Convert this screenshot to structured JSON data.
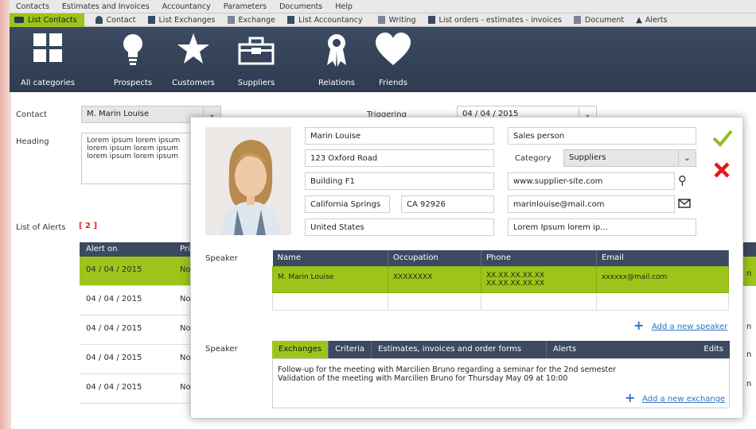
{
  "menu": [
    "Contacts",
    "Estimates and Invoices",
    "Accountancy",
    "Parameters",
    "Documents",
    "Help"
  ],
  "tabs": [
    {
      "label": "List Contacts",
      "icon": "contacts-icon",
      "active": true
    },
    {
      "label": "Contact",
      "icon": "person-icon"
    },
    {
      "label": "List Exchanges",
      "icon": "book-icon"
    },
    {
      "label": "Exchange",
      "icon": "document-icon"
    },
    {
      "label": "List Accountancy",
      "icon": "book-icon"
    },
    {
      "label": "Writing",
      "icon": "document-icon"
    },
    {
      "label": "List orders - estimates - invoices",
      "icon": "book-icon"
    },
    {
      "label": "Document",
      "icon": "document-icon"
    },
    {
      "label": "Alerts",
      "icon": "warning-icon"
    }
  ],
  "toolbar": [
    {
      "label": "All categories",
      "icon": "grid-icon"
    },
    {
      "label": "Prospects",
      "icon": "lightbulb-icon"
    },
    {
      "label": "Customers",
      "icon": "star-icon"
    },
    {
      "label": "Suppliers",
      "icon": "toolbox-icon"
    },
    {
      "label": "Relations",
      "icon": "ribbon-icon"
    },
    {
      "label": "Friends",
      "icon": "heart-icon"
    }
  ],
  "form": {
    "contact_label": "Contact",
    "contact_value": "M. Marin Louise",
    "triggering_label": "Triggering",
    "triggering_value": "04 / 04 / 2015",
    "heading_label": "Heading",
    "heading_value": "Lorem ipsum lorem ipsum\nlorem ipsum lorem ipsum\nlorem ipsum lorem ipsum",
    "alerts_label": "List of Alerts",
    "alerts_count": "[ 2 ]"
  },
  "alerts": {
    "headers": [
      "Alert on",
      "Pri"
    ],
    "rows": [
      {
        "date": "04 / 04 / 2015",
        "pri": "No"
      },
      {
        "date": "04 / 04 / 2015",
        "pri": "No"
      },
      {
        "date": "04 / 04 / 2015",
        "pri": "No"
      },
      {
        "date": "04 / 04 / 2015",
        "pri": "No"
      },
      {
        "date": "04 / 04 / 2015",
        "pri": "No"
      }
    ]
  },
  "contact_card": {
    "name": "Marin Louise",
    "address1": "123 Oxford Road",
    "address2": "Building F1",
    "city": "California Springs",
    "state_zip": "CA 92926",
    "country": "United States",
    "role": "Sales person",
    "category_label": "Category",
    "category_value": "Suppliers",
    "website": "www.supplier-site.com",
    "email": "marinlouise@mail.com",
    "notes": "Lorem Ipsum lorem ip..."
  },
  "speakers": {
    "label": "Speaker",
    "headers": [
      "Name",
      "Occupation",
      "Phone",
      "Email"
    ],
    "rows": [
      {
        "name": "M. Marin Louise",
        "occupation": "XXXXXXXX",
        "phone1": "XX.XX.XX.XX.XX",
        "phone2": "XX.XX.XX.XX.XX",
        "email": "xxxxxx@mail.com"
      }
    ],
    "add_label": "Add a new speaker"
  },
  "exchanges": {
    "label": "Speaker",
    "tabs": [
      "Exchanges",
      "Criteria",
      "Estimates, invoices and order forms",
      "Alerts"
    ],
    "edits_label": "Edits",
    "lines": [
      "Follow-up for the meeting with Marcilien Bruno regarding a seminar for the 2nd semester",
      "Validation of the meeting with Marcilien Bruno for Thursday May 09 at 10:00"
    ],
    "add_label": "Add a new exchange"
  },
  "colors": {
    "accent": "#9cc41b",
    "header": "#3b4a61",
    "confirm": "#8fbf1f",
    "cancel": "#e01b1b",
    "link": "#2b74c6"
  }
}
